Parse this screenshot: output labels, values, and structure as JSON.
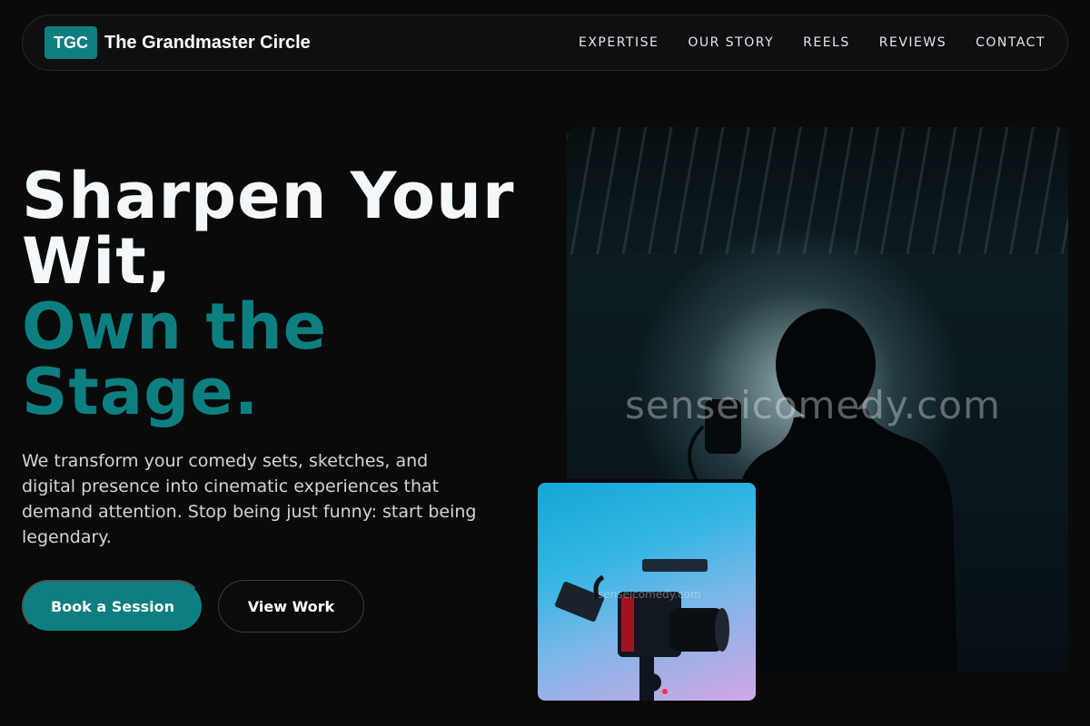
{
  "nav": {
    "logo": "TGC",
    "brand": "The Grandmaster Circle",
    "links": [
      "EXPERTISE",
      "OUR STORY",
      "REELS",
      "REVIEWS",
      "CONTACT"
    ]
  },
  "hero": {
    "title_line1": "Sharpen Your Wit,",
    "title_line2": "Own the Stage.",
    "description": "We transform your comedy sets, sketches, and digital presence into cinematic experiences that demand attention. Stop being just funny: start being legendary.",
    "primary_button": "Book a Session",
    "secondary_button": "View Work"
  },
  "media": {
    "main_watermark": "senseicomedy.com",
    "small_watermark": "senseicomedy.com"
  },
  "colors": {
    "accent": "#0e7f80",
    "background": "#0a0a0b"
  }
}
